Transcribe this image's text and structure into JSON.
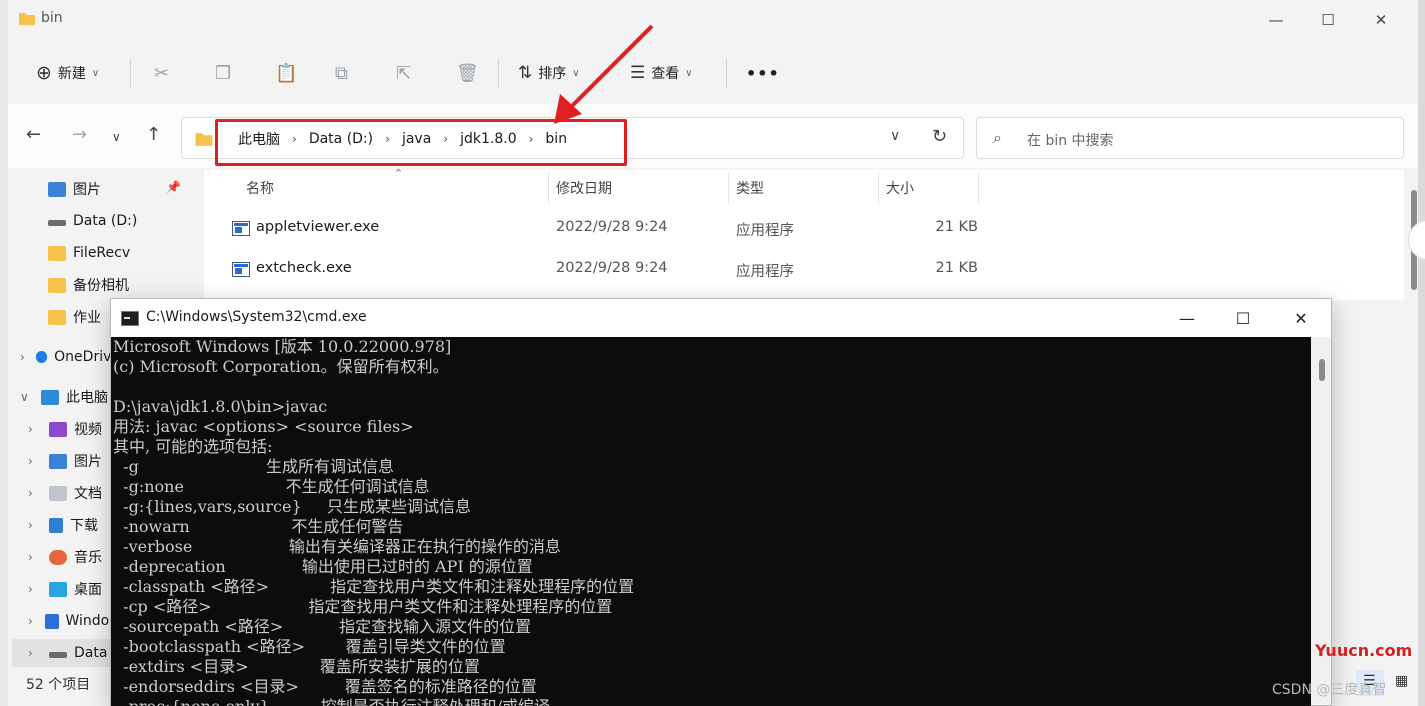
{
  "explorer": {
    "title": "bin",
    "toolbar": {
      "new_label": "新建",
      "sort_label": "排序",
      "view_label": "查看",
      "more_label": "•••"
    },
    "breadcrumbs": [
      "此电脑",
      "Data (D:)",
      "java",
      "jdk1.8.0",
      "bin"
    ],
    "search_placeholder": "在 bin 中搜索",
    "columns": {
      "name": "名称",
      "date": "修改日期",
      "type": "类型",
      "size": "大小"
    },
    "files": [
      {
        "name": "appletviewer.exe",
        "date": "2022/9/28 9:24",
        "type": "应用程序",
        "size": "21 KB"
      },
      {
        "name": "extcheck.exe",
        "date": "2022/9/28 9:24",
        "type": "应用程序",
        "size": "21 KB"
      }
    ],
    "sidebar": {
      "quick": [
        {
          "label": "图片",
          "icon": "pictures-icon"
        },
        {
          "label": "Data (D:)",
          "icon": "drive-icon"
        },
        {
          "label": "FileRecv",
          "icon": "folder-icon"
        },
        {
          "label": "备份相机",
          "icon": "folder-icon"
        },
        {
          "label": "作业",
          "icon": "folder-icon"
        }
      ],
      "onedrive": "OneDrive",
      "this_pc": "此电脑",
      "pc_items": [
        {
          "label": "视频",
          "icon": "video-icon"
        },
        {
          "label": "图片",
          "icon": "pictures-icon"
        },
        {
          "label": "文档",
          "icon": "documents-icon"
        },
        {
          "label": "下载",
          "icon": "download-icon"
        },
        {
          "label": "音乐",
          "icon": "music-icon"
        },
        {
          "label": "桌面",
          "icon": "desktop-icon"
        },
        {
          "label": "Windows",
          "icon": "windows-drive-icon"
        },
        {
          "label": "Data",
          "icon": "drive-icon"
        }
      ]
    },
    "status": "52 个项目"
  },
  "cmd": {
    "title": "C:\\Windows\\System32\\cmd.exe",
    "lines": [
      "Microsoft Windows [版本 10.0.22000.978]",
      "(c) Microsoft Corporation。保留所有权利。",
      "",
      "D:\\java\\jdk1.8.0\\bin>javac",
      "用法: javac <options> <source files>",
      "其中, 可能的选项包括:",
      "  -g                         生成所有调试信息",
      "  -g:none                    不生成任何调试信息",
      "  -g:{lines,vars,source}     只生成某些调试信息",
      "  -nowarn                    不生成任何警告",
      "  -verbose                   输出有关编译器正在执行的操作的消息",
      "  -deprecation               输出使用已过时的 API 的源位置",
      "  -classpath <路径>            指定查找用户类文件和注释处理程序的位置",
      "  -cp <路径>                   指定查找用户类文件和注释处理程序的位置",
      "  -sourcepath <路径>           指定查找输入源文件的位置",
      "  -bootclasspath <路径>        覆盖引导类文件的位置",
      "  -extdirs <目录>              覆盖所安装扩展的位置",
      "  -endorseddirs <目录>         覆盖签名的标准路径的位置",
      "  -proc:{none,only}          控制是否执行注释处理和/或编译。"
    ]
  },
  "watermarks": {
    "yuucn": "Yuucn.com",
    "csdn": "CSDN @三度真智"
  },
  "colors": {
    "highlight": "#e02020",
    "console_bg": "#0c0c0c",
    "console_fg": "#cccccc"
  }
}
